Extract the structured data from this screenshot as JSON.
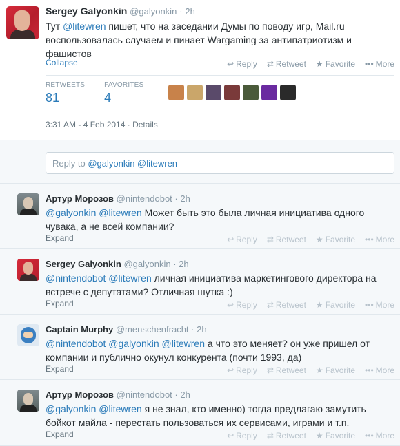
{
  "main_tweet": {
    "name": "Sergey Galyonkin",
    "handle": "@galyonkin",
    "time": "2h",
    "text_prefix": "Тут ",
    "mention": "@litewren",
    "text_rest": " пишет, что на заседании Думы по поводу игр, Mail.ru воспользовалась случаем и пинает Wargaming за антипатриотизм и фашистов",
    "collapse_label": "Collapse",
    "stats": {
      "retweets_label": "RETWEETS",
      "retweets_value": "81",
      "favorites_label": "FAVORITES",
      "favorites_value": "4"
    },
    "favoriter_avatar_colors": [
      "#c8824a",
      "#caa66a",
      "#5a4a6a",
      "#7a3a3a",
      "#4a5a3a",
      "#6a2aa0",
      "#2a2a2a"
    ],
    "timestamp": "3:31 AM - 4 Feb 2014",
    "details_label": "Details"
  },
  "actions": {
    "reply": "Reply",
    "retweet": "Retweet",
    "favorite": "Favorite",
    "more": "More"
  },
  "reply_box": {
    "placeholder_prefix": "Reply to ",
    "mentions": "@galyonkin @litewren"
  },
  "replies": [
    {
      "name": "Артур Морозов",
      "handle": "@nintendobot",
      "time": "2h",
      "mentions": "@galyonkin @litewren",
      "text": " Может быть это была личная инициатива одного чувака, а не всей компании?",
      "expand": "Expand",
      "avatar": "avatar-artur"
    },
    {
      "name": "Sergey Galyonkin",
      "handle": "@galyonkin",
      "time": "2h",
      "mentions": "@nintendobot @litewren",
      "text": " личная инициатива маркетингового директора на встрече с депутатами? Отличная шутка :)",
      "expand": "Expand",
      "avatar": "avatar-sergey"
    },
    {
      "name": "Captain Murphy",
      "handle": "@menschenfracht",
      "time": "2h",
      "mentions": "@nintendobot @galyonkin @litewren",
      "text": " а что это меняет? он уже пришел от компании и публично окунул конкурента (почти 1993, да)",
      "expand": "Expand",
      "avatar": "avatar-murphy"
    },
    {
      "name": "Артур Морозов",
      "handle": "@nintendobot",
      "time": "2h",
      "mentions": "@galyonkin @litewren",
      "text": " я не знал, кто именно) тогда предлагаю замутить бойкот майла - перестать пользоваться их сервисами, играми и т.п.",
      "expand": "Expand",
      "avatar": "avatar-artur"
    }
  ]
}
